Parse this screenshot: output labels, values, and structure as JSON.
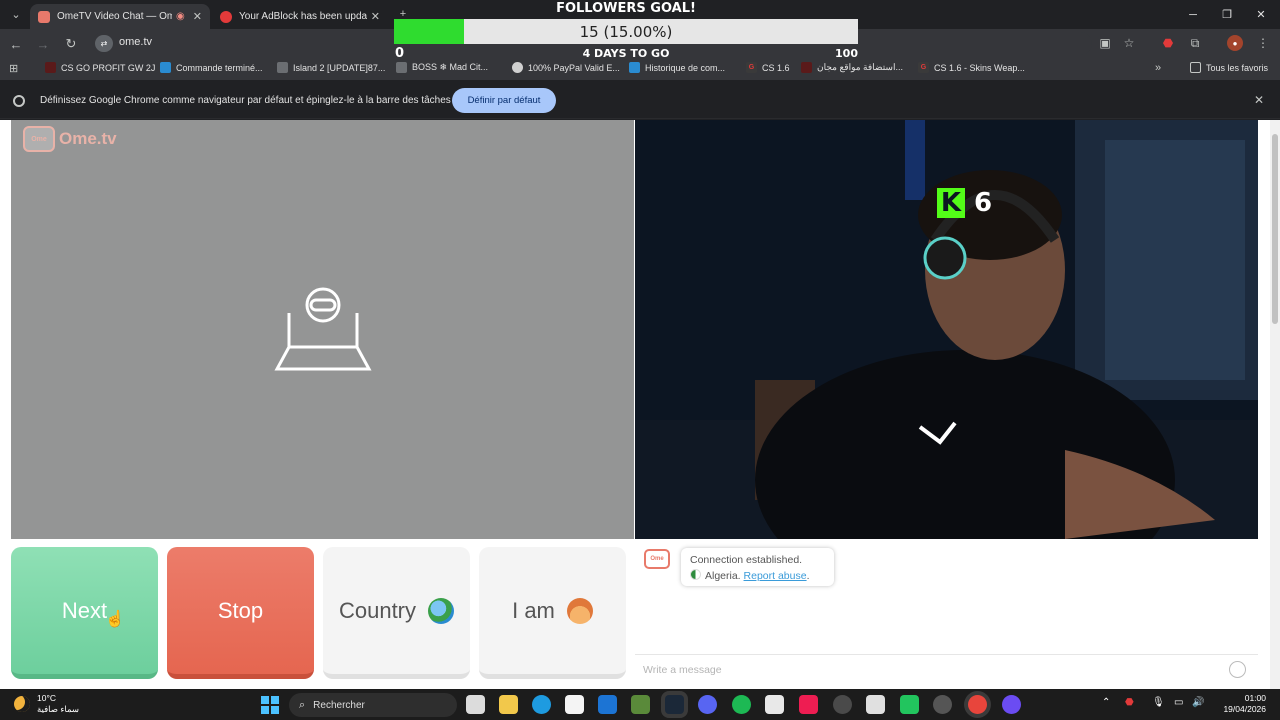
{
  "browser": {
    "tabs": [
      {
        "title": "OmeTV Video Chat — Ome",
        "active": true
      },
      {
        "title": "Your AdBlock has been update",
        "active": false
      }
    ],
    "url": "ome.tv",
    "bookmarks": [
      "CS GO PROFIT GW 2J",
      "Commande terminé...",
      "Island 2 [UPDATE]87...",
      "BOSS ❄ Mad Cit...",
      "100% PayPal Valid E...",
      "Historique de com...",
      "CS 1.6",
      "استضافة مواقع مجان...",
      "CS 1.6 - Skins Weap...",
      "Tous les favoris"
    ],
    "infobar": {
      "message": "Définissez Google Chrome comme navigateur par défaut et épinglez-le à la barre des tâches",
      "button": "Définir par défaut"
    }
  },
  "goal_overlay": {
    "title": "FOLLOWERS GOAL!",
    "progress_text": "15 (15.00%)",
    "progress_fraction": 0.15,
    "min": "0",
    "max": "100",
    "days_left": "4 DAYS TO GO"
  },
  "ometv": {
    "logo": "Ome.tv",
    "kick_badge": "6",
    "buttons": {
      "next": "Next",
      "stop": "Stop",
      "country": "Country",
      "iam": "I am"
    },
    "chat": {
      "status": "Connection established.",
      "country": "Algeria.",
      "report": "Report abuse",
      "placeholder": "Write a message"
    }
  },
  "taskbar": {
    "weather_temp": "10°C",
    "weather_desc": "سماء صافية",
    "search": "Rechercher",
    "time": "01:00",
    "date": "19/04/2026"
  }
}
